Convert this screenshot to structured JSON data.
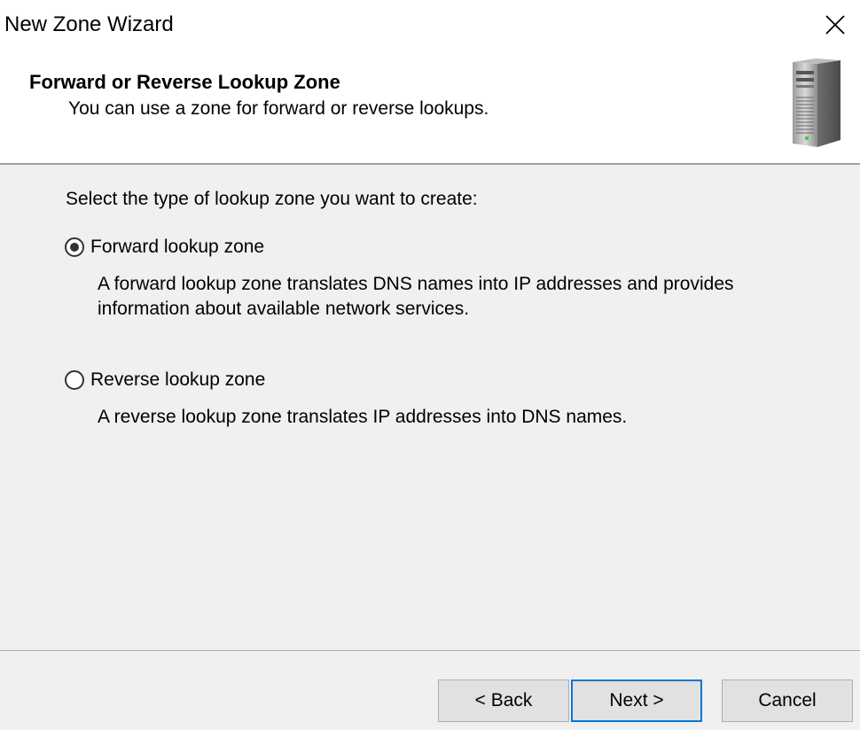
{
  "window": {
    "title": "New Zone Wizard",
    "close_icon": "close-icon"
  },
  "header": {
    "title": "Forward or Reverse Lookup Zone",
    "subtitle": "You can use a zone for forward or reverse lookups.",
    "icon": "server-icon"
  },
  "body": {
    "prompt": "Select the type of lookup zone you want to create:",
    "options": [
      {
        "label": "Forward lookup zone",
        "checked": true,
        "description_lines": [
          "A forward lookup zone translates DNS names into IP addresses and provides",
          "information about available network services."
        ]
      },
      {
        "label": "Reverse lookup zone",
        "checked": false,
        "description_lines": [
          "A reverse lookup zone translates IP addresses into DNS names."
        ]
      }
    ]
  },
  "footer": {
    "back_label": "< Back",
    "next_label": "Next >",
    "cancel_label": "Cancel"
  },
  "colors": {
    "default_button_border": "#0078d7",
    "dialog_background": "#f0f0f0"
  }
}
